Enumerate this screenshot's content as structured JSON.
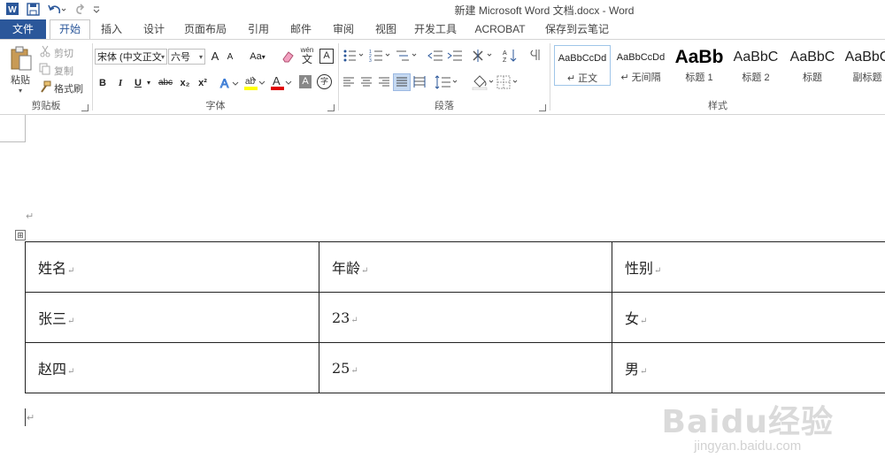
{
  "window": {
    "title": "新建 Microsoft Word 文档.docx - Word"
  },
  "tabs": [
    {
      "label": "文件"
    },
    {
      "label": "开始"
    },
    {
      "label": "插入"
    },
    {
      "label": "设计"
    },
    {
      "label": "页面布局"
    },
    {
      "label": "引用"
    },
    {
      "label": "邮件"
    },
    {
      "label": "审阅"
    },
    {
      "label": "视图"
    },
    {
      "label": "开发工具"
    },
    {
      "label": "ACROBAT"
    },
    {
      "label": "保存到云笔记"
    }
  ],
  "clipboard": {
    "paste": "粘贴",
    "cut": "剪切",
    "copy": "复制",
    "format_painter": "格式刷",
    "group_label": "剪贴板"
  },
  "font": {
    "font_name": "宋体 (中文正文",
    "font_size": "六号",
    "group_label": "字体",
    "wen_label": "wén",
    "wen_char": "文",
    "aa_label": "Aa",
    "a_label": "A",
    "a_big": "A",
    "a_small": "A",
    "bold": "B",
    "italic": "I",
    "underline": "U",
    "strike": "abc",
    "sub": "x₂",
    "sup": "x²",
    "circle_char": "字"
  },
  "paragraph": {
    "group_label": "段落"
  },
  "styles": {
    "group_label": "样式",
    "items": [
      {
        "sample": "AaBbCcDd",
        "name": "正文"
      },
      {
        "sample": "AaBbCcDd",
        "name": "无间隔"
      },
      {
        "sample": "AaBb",
        "name": "标题 1"
      },
      {
        "sample": "AaBbC",
        "name": "标题 2"
      },
      {
        "sample": "AaBbC",
        "name": "标题"
      },
      {
        "sample": "AaBbC",
        "name": "副标题"
      }
    ]
  },
  "document": {
    "paragraph_mark": "↵",
    "table_move_handle": "⊞",
    "table": {
      "rows": [
        [
          "姓名",
          "年龄",
          "性别"
        ],
        [
          "张三",
          "23",
          "女"
        ],
        [
          "赵四",
          "25",
          "男"
        ]
      ]
    }
  },
  "watermark": {
    "logo_text": "Baidu经验",
    "url": "jingyan.baidu.com"
  },
  "colors": {
    "file_tab": "#2b579a",
    "highlight": "#ffff00",
    "font_color": "#e00000"
  }
}
